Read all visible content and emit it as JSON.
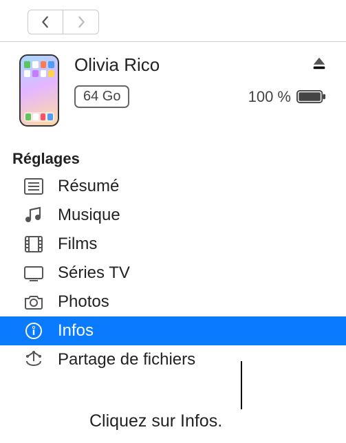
{
  "nav": {
    "back_enabled": true,
    "forward_enabled": false
  },
  "device": {
    "name": "Olivia Rico",
    "capacity": "64 Go",
    "battery_percent": "100 %"
  },
  "sidebar": {
    "section_label": "Réglages",
    "selected_index": 5,
    "items": [
      {
        "label": "Résumé"
      },
      {
        "label": "Musique"
      },
      {
        "label": "Films"
      },
      {
        "label": "Séries TV"
      },
      {
        "label": "Photos"
      },
      {
        "label": "Infos"
      },
      {
        "label": "Partage de fichiers"
      }
    ]
  },
  "callout": {
    "text": "Cliquez sur Infos."
  }
}
